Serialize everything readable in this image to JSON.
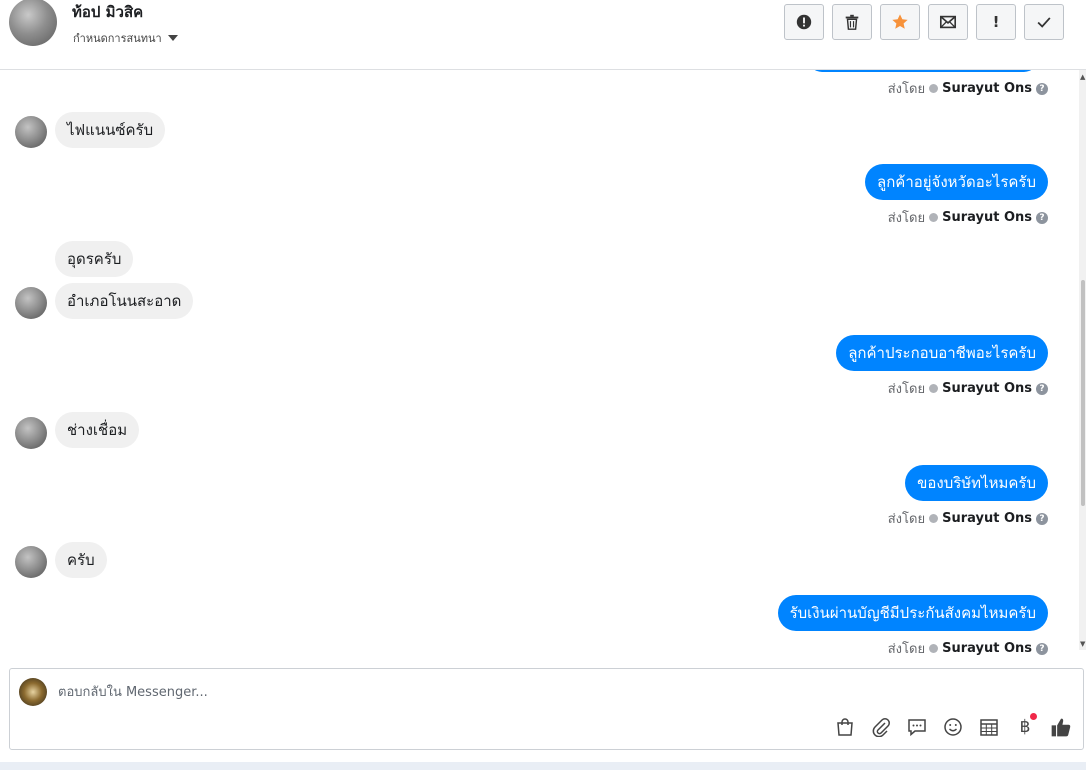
{
  "header": {
    "contact_name": "ท้อป มิวสิค",
    "conversation_setting": "กำหนดการสนทนา",
    "actions": [
      {
        "name": "report-icon",
        "label": "!"
      },
      {
        "name": "trash-icon"
      },
      {
        "name": "star-icon",
        "color": "#f7923a"
      },
      {
        "name": "envelope-icon"
      },
      {
        "name": "exclamation-icon",
        "label": "!"
      },
      {
        "name": "check-icon"
      }
    ]
  },
  "thread": {
    "agent_name": "Surayut Ons",
    "sent_by_label": "ส่งโดย",
    "help_glyph": "?",
    "messages": [
      {
        "dir": "out-partial"
      },
      {
        "dir": "in",
        "text": "ไฟแนนซ์ครับ"
      },
      {
        "dir": "out",
        "text": "ลูกค้าอยู่จังหวัดอะไรครับ"
      },
      {
        "dir": "in",
        "text": "อุดรครับ"
      },
      {
        "dir": "in",
        "text": "อำเภอโนนสะอาด"
      },
      {
        "dir": "out",
        "text": "ลูกค้าประกอบอาชีพอะไรครับ"
      },
      {
        "dir": "in",
        "text": "ช่างเชื่อม"
      },
      {
        "dir": "out",
        "text": "ของบริษัทไหมครับ"
      },
      {
        "dir": "in",
        "text": "ครับ"
      },
      {
        "dir": "out",
        "text": "รับเงินผ่านบัญชีมีประกันสังคมไหมครับ"
      }
    ]
  },
  "composer": {
    "placeholder": "ตอบกลับใน Messenger...",
    "value": "",
    "tools": [
      "bag-icon",
      "paperclip-icon",
      "chat-bubble-icon",
      "smiley-icon",
      "calendar-table-icon",
      "baht-payment-icon",
      "thumbs-up-icon"
    ],
    "baht_glyph": "฿"
  },
  "colors": {
    "outgoing_bubble": "#0084ff",
    "incoming_bubble": "#f0f0f0",
    "star": "#f7923a",
    "notification": "#f02849"
  }
}
